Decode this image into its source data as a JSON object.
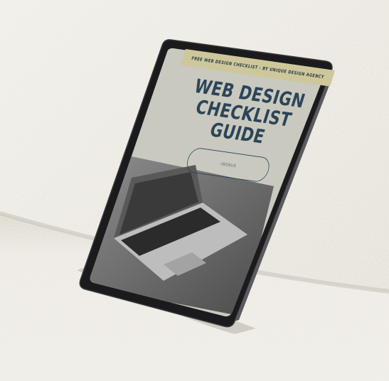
{
  "banner": {
    "text": "FREE WEB DESIGN CHECKLIST - BY UNIQUE DESIGN AGENCY"
  },
  "title": {
    "line1": "WEB DESIGN",
    "line2": "CHECKLIST",
    "line3": "GUIDE"
  },
  "pill": {
    "label": "+BONUS"
  },
  "colors": {
    "banner": "#cdc79a",
    "cover": "#c9c9bf",
    "title": "#2c4458",
    "sofa": "#e9e6de"
  }
}
